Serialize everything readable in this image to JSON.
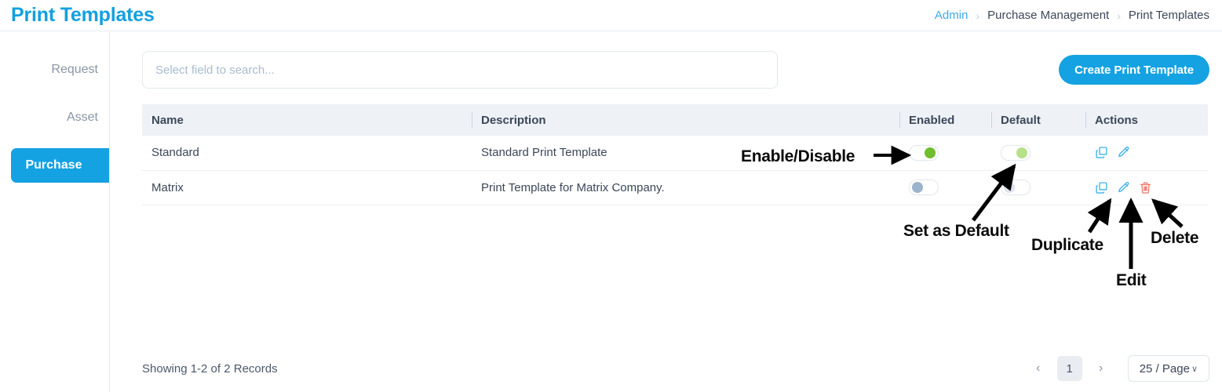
{
  "header": {
    "title": "Print Templates",
    "breadcrumb": [
      {
        "label": "Admin",
        "type": "link"
      },
      {
        "label": "Purchase Management",
        "type": "text"
      },
      {
        "label": "Print Templates",
        "type": "text"
      }
    ],
    "separator": "›"
  },
  "sidebar": {
    "items": [
      {
        "label": "Request",
        "active": false
      },
      {
        "label": "Asset",
        "active": false
      },
      {
        "label": "Purchase",
        "active": true
      }
    ]
  },
  "toolbar": {
    "search_placeholder": "Select field to search...",
    "search_value": "",
    "create_label": "Create Print Template"
  },
  "table": {
    "columns": [
      "Name",
      "Description",
      "Enabled",
      "Default",
      "Actions"
    ],
    "rows": [
      {
        "name": "Standard",
        "description": "Standard Print Template",
        "enabled": "on",
        "default": "on",
        "actions": [
          "duplicate",
          "edit"
        ]
      },
      {
        "name": "Matrix",
        "description": "Print Template for Matrix Company.",
        "enabled": "off",
        "default": "off",
        "actions": [
          "duplicate",
          "edit",
          "delete"
        ]
      }
    ]
  },
  "footer": {
    "records_text": "Showing 1-2 of 2 Records",
    "prev": "‹",
    "next": "›",
    "current_page": "1",
    "page_size": "25 / Page",
    "page_size_chevron": "∨"
  },
  "annotations": [
    {
      "label": "Enable/Disable"
    },
    {
      "label": "Set as Default"
    },
    {
      "label": "Duplicate"
    },
    {
      "label": "Edit"
    },
    {
      "label": "Delete"
    }
  ],
  "colors": {
    "brand": "#14a2e2",
    "title": "#12a0e0",
    "toggle_on": "#6fbe2e",
    "toggle_on_muted": "#b7e08a",
    "toggle_off": "#9bb3cc",
    "toggle_off_muted": "#dde4ed",
    "icon_blue": "#3bb2e8",
    "icon_red": "#ef7c72",
    "header_bg": "#eef2f7",
    "text": "#3b4758"
  }
}
